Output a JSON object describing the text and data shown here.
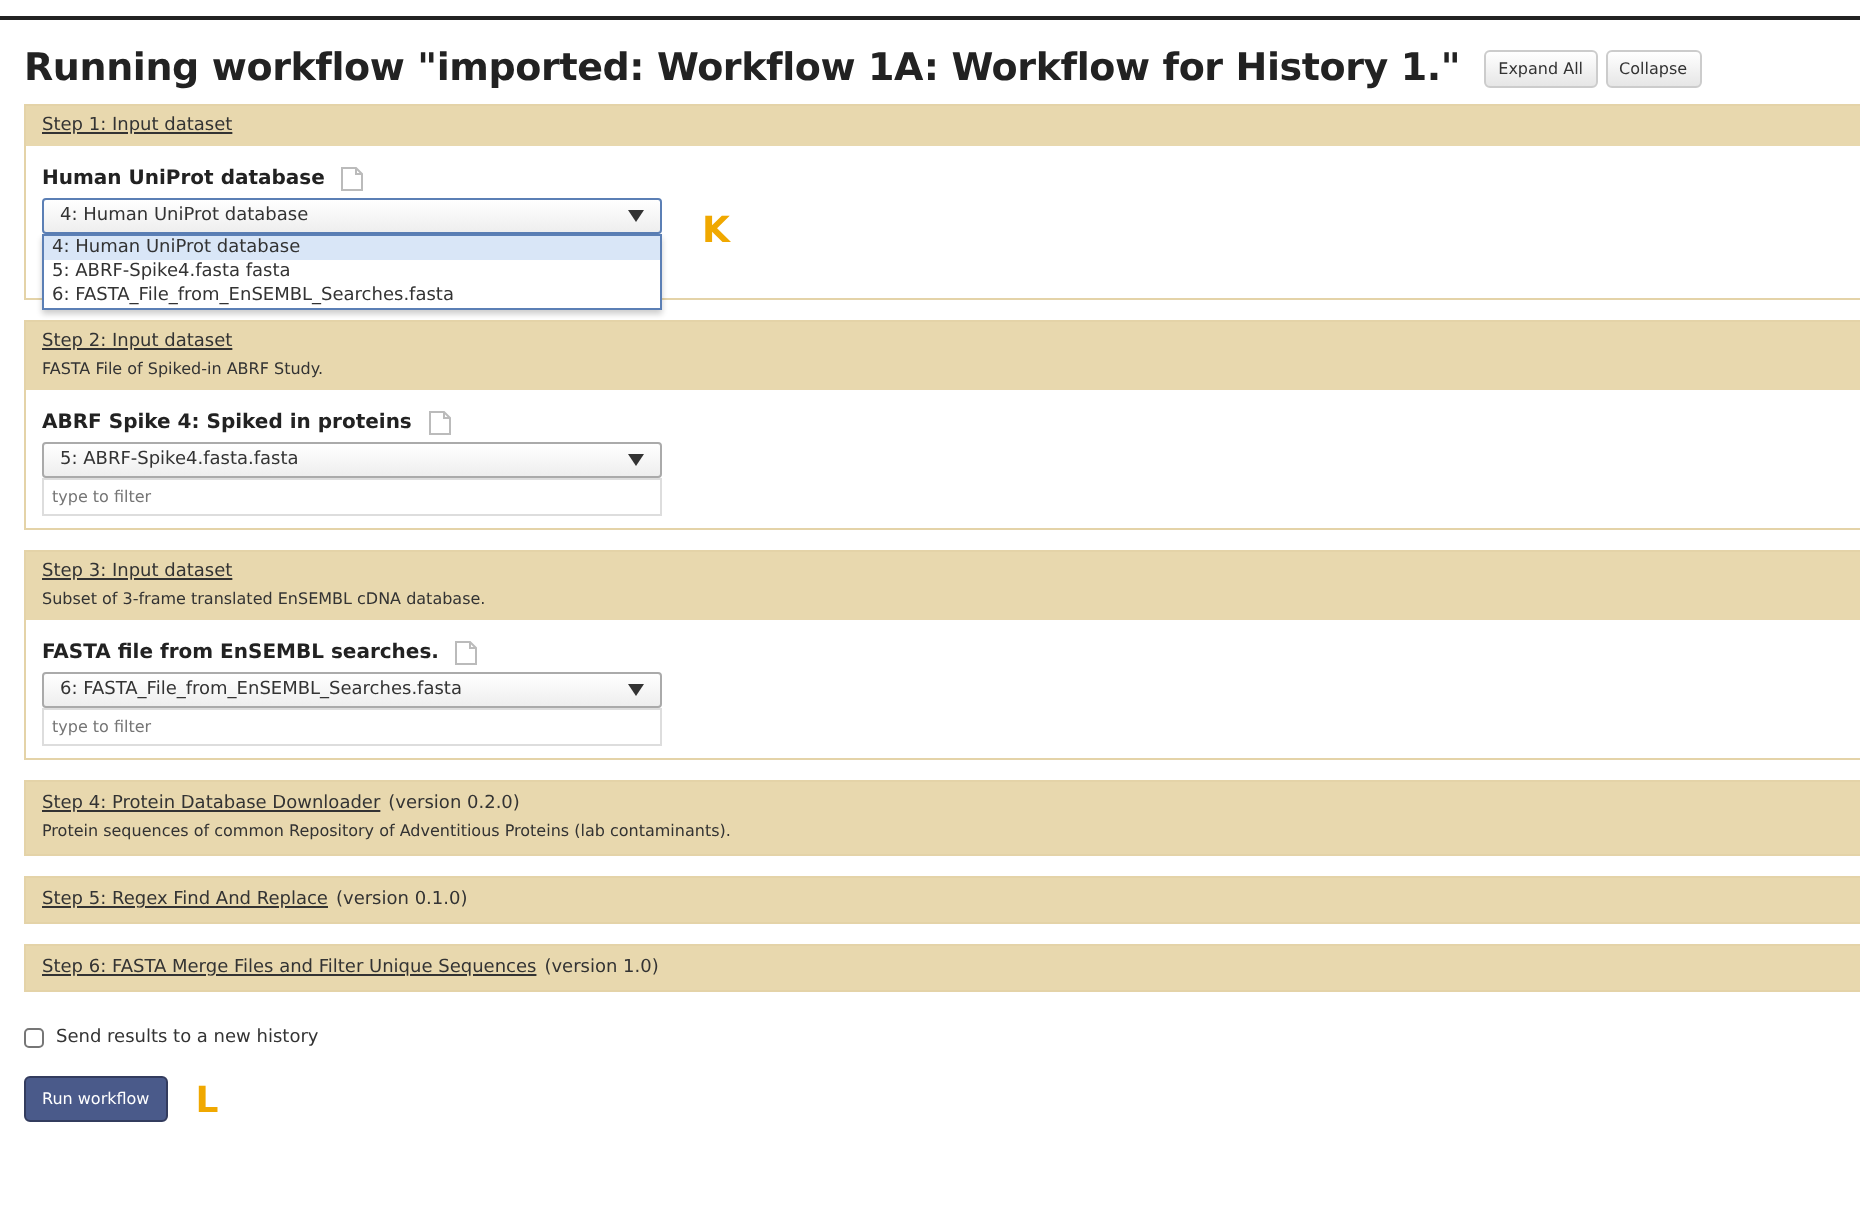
{
  "title": "Running workflow \"imported: Workflow 1A: Workflow for History 1.\"",
  "header_buttons": [
    "Expand All",
    "Collapse"
  ],
  "steps": [
    {
      "kind": "input",
      "label": "Step 1: Input dataset",
      "param": "Human UniProt database",
      "value": "4: Human UniProt database",
      "expanded": true,
      "options": [
        {
          "label": "4: Human UniProt database",
          "selected": true
        },
        {
          "label": "5: ABRF-Spike4.fasta fasta",
          "selected": false
        },
        {
          "label": "6: FASTA_File_from_EnSEMBL_Searches.fasta",
          "selected": false
        }
      ],
      "annotation": "K"
    },
    {
      "kind": "input",
      "label": "Step 2: Input dataset",
      "description": "FASTA File of Spiked-in ABRF Study.",
      "param": "ABRF Spike 4: Spiked in proteins",
      "value": "5: ABRF-Spike4.fasta.fasta",
      "expanded": false,
      "filter_placeholder": "type to filter"
    },
    {
      "kind": "input",
      "label": "Step 3: Input dataset",
      "description": "Subset of 3-frame translated EnSEMBL cDNA database.",
      "param": "FASTA file from EnSEMBL searches.",
      "value": "6: FASTA_File_from_EnSEMBL_Searches.fasta",
      "expanded": false,
      "filter_placeholder": "type to filter"
    },
    {
      "kind": "tool",
      "label": "Step 4: Protein Database Downloader",
      "version": "(version 0.2.0)",
      "description": "Protein sequences of common Repository of Adventitious Proteins (lab contaminants)."
    },
    {
      "kind": "tool",
      "label": "Step 5: Regex Find And Replace",
      "version": "(version 0.1.0)"
    },
    {
      "kind": "tool",
      "label": "Step 6: FASTA Merge Files and Filter Unique Sequences",
      "version": "(version 1.0)"
    }
  ],
  "new_history": {
    "label": "Send results to a new history",
    "checked": false
  },
  "run_button": "Run workflow",
  "run_annotation": "L"
}
